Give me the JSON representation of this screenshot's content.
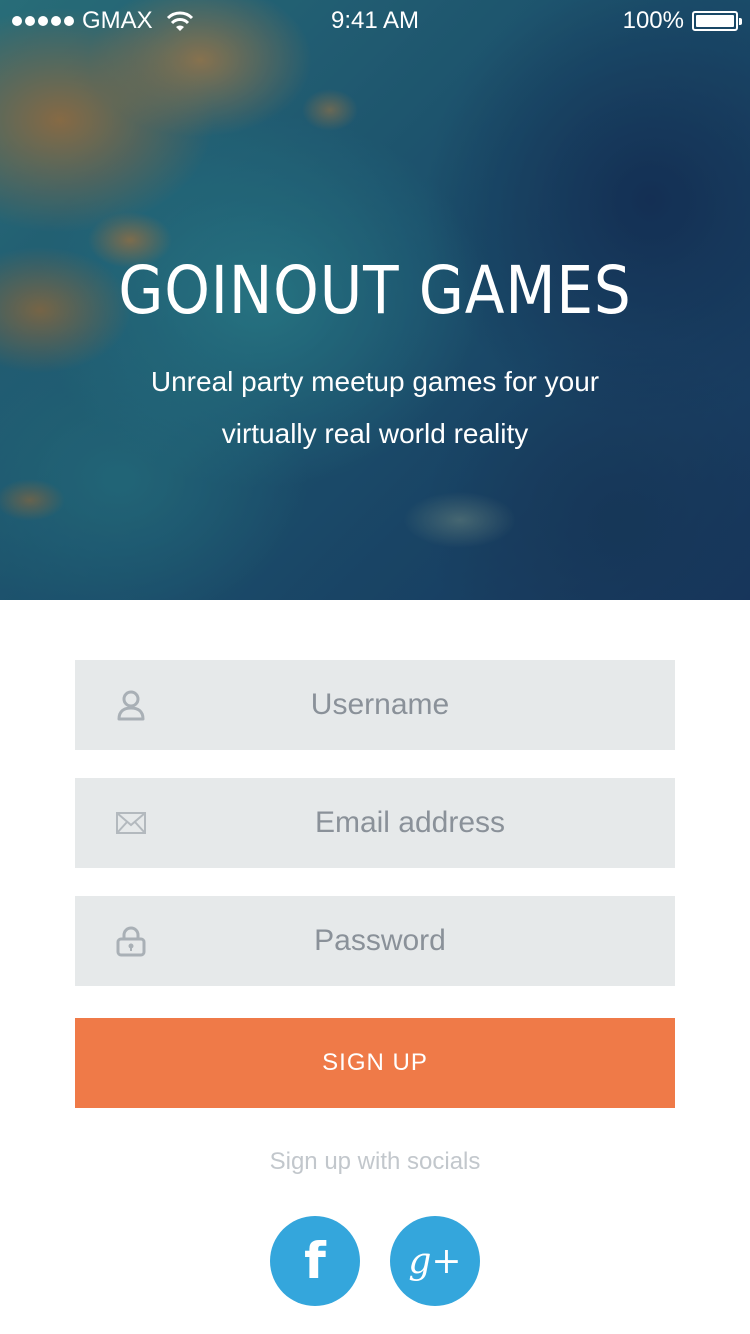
{
  "status_bar": {
    "carrier": "GMAX",
    "time": "9:41 AM",
    "battery": "100%"
  },
  "hero": {
    "title": "GOINOUT GAMES",
    "subtitle": "Unreal party meetup games for your virtually real world reality"
  },
  "form": {
    "username_placeholder": "Username",
    "email_placeholder": "Email address",
    "password_placeholder": "Password",
    "signup_label": "SIGN UP",
    "socials_label": "Sign up with socials",
    "facebook_glyph": "f",
    "google_glyph": "g+"
  },
  "icons": {
    "user": "user-icon",
    "email": "envelope-icon",
    "password": "lock-icon",
    "facebook": "facebook-icon",
    "google": "google-plus-icon"
  },
  "colors": {
    "accent": "#ef7a48",
    "social": "#34a6dc",
    "field_bg": "#e6e9ea"
  }
}
